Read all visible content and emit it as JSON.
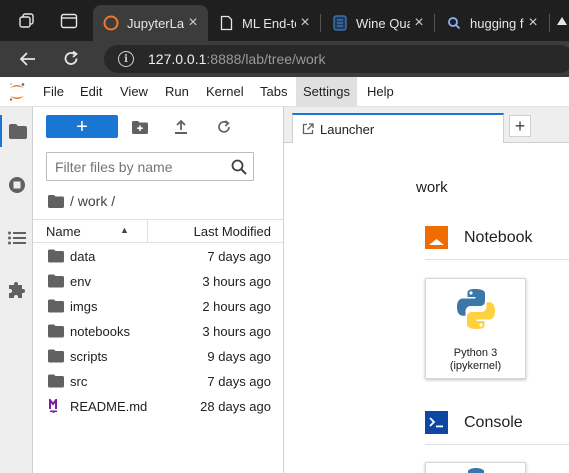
{
  "browser": {
    "tabs": [
      {
        "title": "JupyterLab",
        "active": true,
        "icon": "jupyter-icon"
      },
      {
        "title": "ML End-to-End",
        "active": false,
        "icon": "page-icon"
      },
      {
        "title": "Wine Quality",
        "active": false,
        "icon": "dataset-icon"
      },
      {
        "title": "hugging face",
        "active": false,
        "icon": "search-icon"
      }
    ],
    "close_glyph": "×",
    "url_host": "127.0.0.1",
    "url_rest": ":8888/lab/tree/work"
  },
  "menubar": {
    "items": [
      "File",
      "Edit",
      "View",
      "Run",
      "Kernel",
      "Tabs",
      "Settings",
      "Help"
    ],
    "active_item": "Settings"
  },
  "filebrowser": {
    "new_label": "+",
    "filter_placeholder": "Filter files by name",
    "breadcrumb": "/ work /",
    "columns": {
      "name": "Name",
      "modified": "Last Modified"
    },
    "files": [
      {
        "name": "data",
        "modified": "7 days ago",
        "type": "folder"
      },
      {
        "name": "env",
        "modified": "3 hours ago",
        "type": "folder"
      },
      {
        "name": "imgs",
        "modified": "2 hours ago",
        "type": "folder"
      },
      {
        "name": "notebooks",
        "modified": "3 hours ago",
        "type": "folder"
      },
      {
        "name": "scripts",
        "modified": "9 days ago",
        "type": "folder"
      },
      {
        "name": "src",
        "modified": "7 days ago",
        "type": "folder"
      },
      {
        "name": "README.md",
        "modified": "28 days ago",
        "type": "markdown"
      }
    ]
  },
  "launcher": {
    "tab_label": "Launcher",
    "add_tab": "+",
    "title": "work",
    "notebook_section": "Notebook",
    "kernel_name": "Python 3",
    "kernel_sub": "(ipykernel)",
    "console_section": "Console"
  },
  "colors": {
    "accent": "#1976d2",
    "jupyter_orange": "#f37726",
    "notebook_orange": "#ef6c00",
    "console_blue": "#0d47a1",
    "markdown_purple": "#7b1fa2"
  }
}
